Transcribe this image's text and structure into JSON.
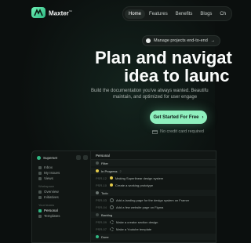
{
  "brand": {
    "name": "Maxter",
    "mark": "™"
  },
  "nav": {
    "links": [
      "Home",
      "Features",
      "Benefits",
      "Blogs",
      "Ch"
    ]
  },
  "badge": {
    "text": "Manage projects end-to-end",
    "arrow": "→"
  },
  "hero": {
    "title_line1": "Plan and navigat",
    "title_line2": "idea to launc",
    "subtitle_line1": "Build the documentation you've always wanted. Beautifu",
    "subtitle_line2": "maintain, and optimized for user engage"
  },
  "cta": {
    "label": "Get Started For Free",
    "arrow": "›"
  },
  "note": {
    "text": "No credit card required"
  },
  "app": {
    "workspace": "Superset",
    "sidebar": [
      {
        "label": "Inbox"
      },
      {
        "label": "My Issues"
      },
      {
        "label": "Views"
      }
    ],
    "section_workspace": "Workspace",
    "sidebar2": [
      {
        "label": "Overview"
      },
      {
        "label": "Initiatives"
      }
    ],
    "section_teams": "Your teams",
    "sidebar3": [
      {
        "label": "Personal"
      },
      {
        "label": "Templates"
      }
    ],
    "tab_title": "Personal",
    "rows": [
      {
        "type": "grp",
        "text": "Filter"
      },
      {
        "type": "grp",
        "text": "In Progress",
        "count": "2"
      },
      {
        "type": "row",
        "id": "PSR-12",
        "text": "Making Superlinear design system"
      },
      {
        "type": "row",
        "id": "PSR-10",
        "text": "Create a working prototype"
      },
      {
        "type": "grp",
        "text": "Todo"
      },
      {
        "type": "row",
        "id": "PSR-03",
        "text": "Add a landing page for the design system on Framer"
      },
      {
        "type": "row",
        "id": "PSR-04",
        "text": "Add a few website page on Figma"
      },
      {
        "type": "grp",
        "text": "Backlog"
      },
      {
        "type": "row",
        "id": "PSR-09",
        "text": "Make a creator section design"
      },
      {
        "type": "row",
        "id": "PSR-07",
        "text": "Make a Youtube template"
      },
      {
        "type": "grp",
        "text": "Done"
      }
    ]
  },
  "colors": {
    "accent": "#8ff0be",
    "background": "#0b0f0e"
  }
}
